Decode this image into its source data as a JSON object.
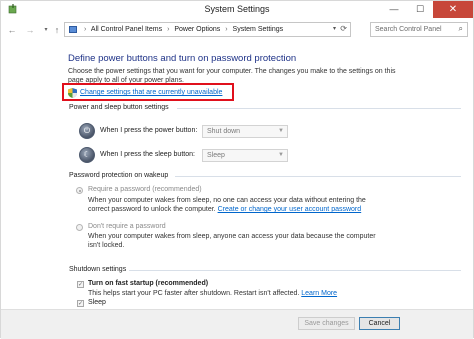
{
  "window": {
    "title": "System Settings",
    "controls": {
      "minimize": "—",
      "maximize": "☐",
      "close": "✕"
    }
  },
  "nav": {
    "back": "←",
    "forward": "→",
    "history": "▾",
    "up": "↑",
    "breadcrumbs": [
      "All Control Panel Items",
      "Power Options",
      "System Settings"
    ],
    "separator": "›",
    "dropdown": "▾",
    "refresh": "⟳",
    "search_placeholder": "Search Control Panel",
    "search_icon": "⌕"
  },
  "main": {
    "heading": "Define power buttons and turn on password protection",
    "intro": "Choose the power settings that you want for your computer. The changes you make to the settings on this page apply to all of your power plans.",
    "change_settings_link": "Change settings that are currently unavailable",
    "power_section": {
      "title": "Power and sleep button settings",
      "power_button_label": "When I press the power button:",
      "power_button_value": "Shut down",
      "sleep_button_label": "When I press the sleep button:",
      "sleep_button_value": "Sleep"
    },
    "password_section": {
      "title": "Password protection on wakeup",
      "require_label": "Require a password (recommended)",
      "require_desc": "When your computer wakes from sleep, no one can access your data without entering the correct password to unlock the computer.",
      "require_link": "Create or change your user account password",
      "dont_label": "Don't require a password",
      "dont_desc": "When your computer wakes from sleep, anyone can access your data because the computer isn't locked."
    },
    "shutdown_section": {
      "title": "Shutdown settings",
      "fast_startup_label": "Turn on fast startup (recommended)",
      "fast_startup_desc": "This helps start your PC faster after shutdown. Restart isn't affected.",
      "learn_more": "Learn More",
      "sleep_label": "Sleep",
      "check_mark": "✓"
    }
  },
  "footer": {
    "save_label": "Save changes",
    "cancel_label": "Cancel"
  },
  "colors": {
    "heading": "#1e3287",
    "link": "#0066cc",
    "highlight_box": "#e0101c",
    "close_button": "#c7473a"
  },
  "icons": {
    "app": "power-options-icon",
    "shield": "uac-shield-icon",
    "power_button": "power-button-icon",
    "sleep_button": "sleep-button-icon"
  }
}
